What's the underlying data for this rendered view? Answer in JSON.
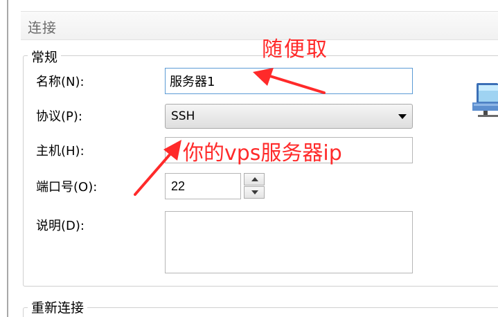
{
  "section": {
    "title": "连接"
  },
  "general_group": {
    "title": "常规",
    "name_label": "名称(N):",
    "name_value": "服务器1",
    "protocol_label": "协议(P):",
    "protocol_value": "SSH",
    "host_label": "主机(H):",
    "host_value": "",
    "port_label": "端口号(O):",
    "port_value": "22",
    "description_label": "说明(D):",
    "description_value": ""
  },
  "reconnect_group": {
    "title": "重新连接"
  },
  "annotations": {
    "name_hint": "随便取",
    "host_hint": "你的vps服务器ip",
    "color": "#ff2a2a"
  },
  "icons": {
    "network": "network-computer-icon",
    "dropdown": "chevron-down-icon",
    "spin_up": "spin-up-icon",
    "spin_down": "spin-down-icon"
  }
}
